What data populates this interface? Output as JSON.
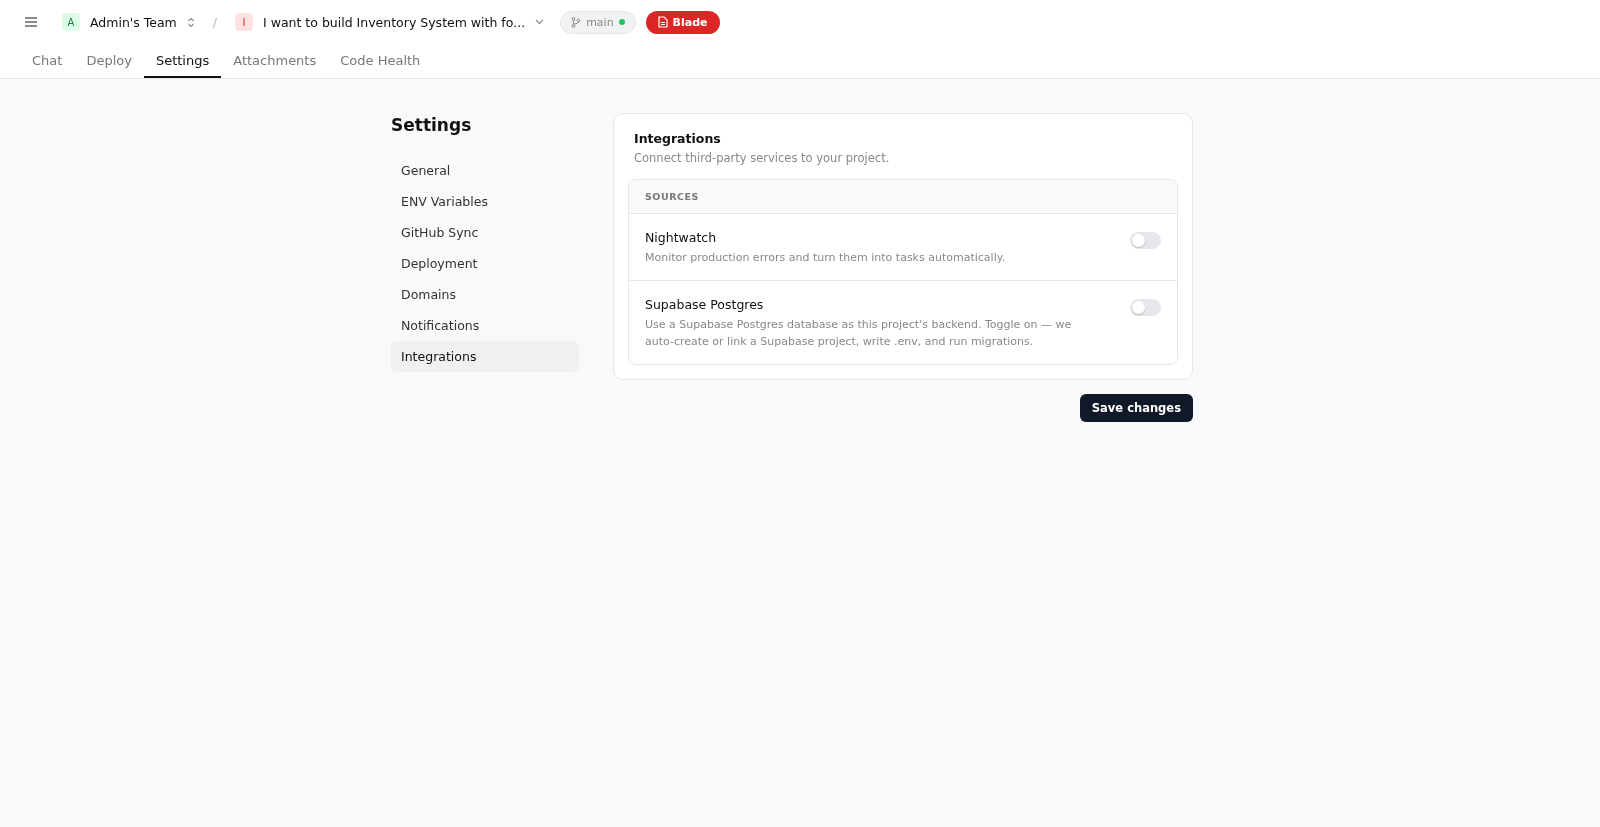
{
  "header": {
    "separator": "/",
    "team": {
      "initial": "A",
      "name": "Admin's Team"
    },
    "project": {
      "initial": "I",
      "name": "I want to build Inventory System with fo..."
    },
    "branch": {
      "name": "main",
      "online": true
    },
    "blade_button": "Blade"
  },
  "tabs": [
    {
      "label": "Chat",
      "selected": false
    },
    {
      "label": "Deploy",
      "selected": false
    },
    {
      "label": "Settings",
      "selected": true
    },
    {
      "label": "Attachments",
      "selected": false
    },
    {
      "label": "Code Health",
      "selected": false
    }
  ],
  "sidebar": {
    "title": "Settings",
    "items": [
      {
        "label": "General",
        "selected": false
      },
      {
        "label": "ENV Variables",
        "selected": false
      },
      {
        "label": "GitHub Sync",
        "selected": false
      },
      {
        "label": "Deployment",
        "selected": false
      },
      {
        "label": "Domains",
        "selected": false
      },
      {
        "label": "Notifications",
        "selected": false
      },
      {
        "label": "Integrations",
        "selected": true
      }
    ]
  },
  "panel": {
    "title": "Integrations",
    "subtitle": "Connect third-party services to your project.",
    "section": "SOURCES",
    "integrations": [
      {
        "name": "Nightwatch",
        "description": "Monitor production errors and turn them into tasks automatically.",
        "on": false
      },
      {
        "name": "Supabase Postgres",
        "description": "Use a Supabase Postgres database as this project's backend. Toggle on — we auto-create or link a Supabase project, write .env, and run migrations.",
        "on": false
      }
    ]
  },
  "save_button": "Save changes"
}
